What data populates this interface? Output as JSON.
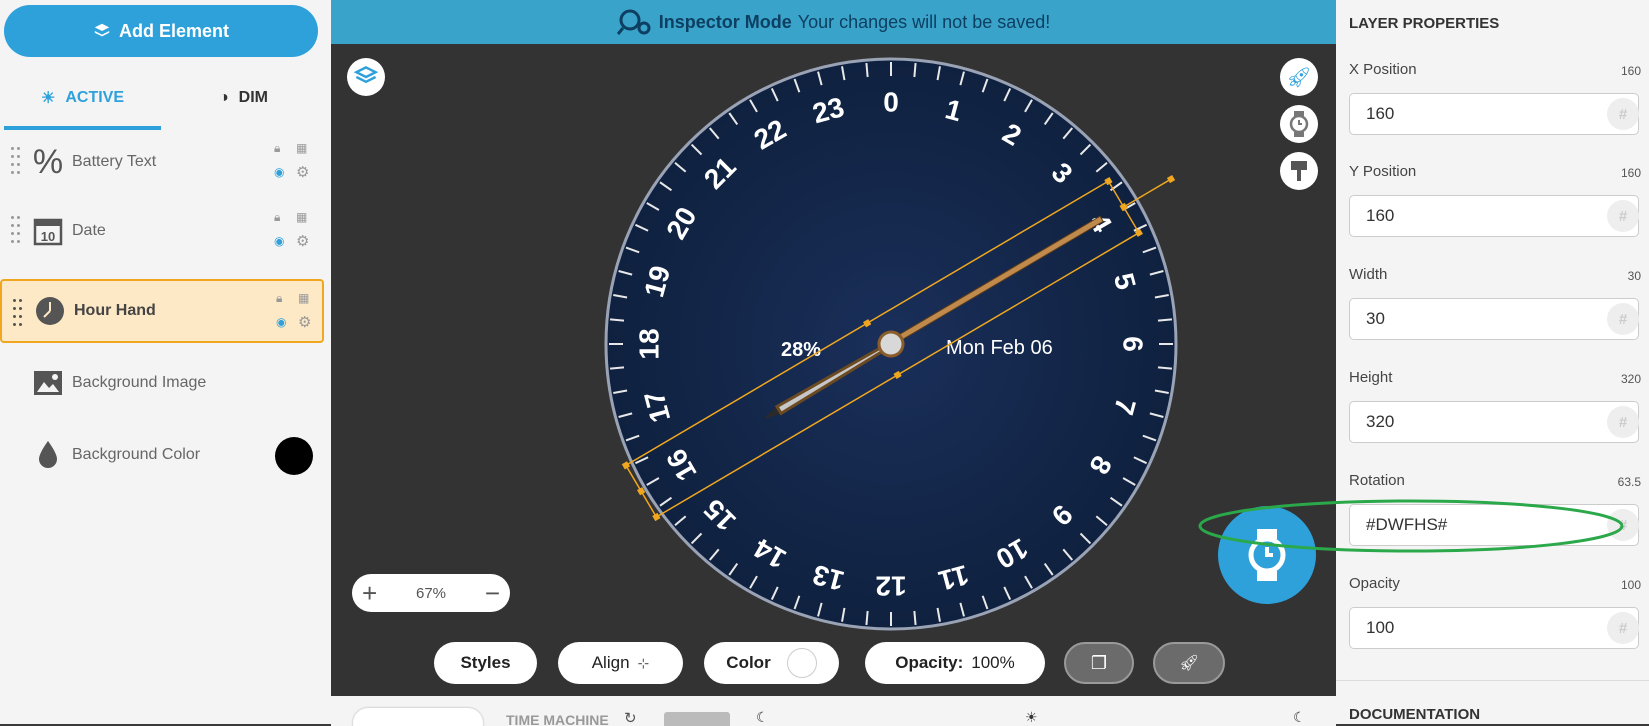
{
  "left_panel": {
    "add_button": "Add Element",
    "tabs": {
      "active": "ACTIVE",
      "dim": "DIM"
    },
    "layers": [
      {
        "name": "Battery Text",
        "icon": "percent-icon"
      },
      {
        "name": "Date",
        "icon": "calendar-icon"
      },
      {
        "name": "Hour Hand",
        "icon": "clock-icon",
        "selected": true
      },
      {
        "name": "Background Image",
        "icon": "image-icon"
      },
      {
        "name": "Background Color",
        "icon": "droplet-icon",
        "swatch": "#000000"
      }
    ]
  },
  "header": {
    "title": "Inspector Mode",
    "subtitle": "Your changes will not be saved!"
  },
  "watch": {
    "battery": "28%",
    "date": "Mon Feb 06",
    "hour_numbers": [
      "0",
      "1",
      "2",
      "3",
      "4",
      "5",
      "6",
      "7",
      "8",
      "9",
      "10",
      "11",
      "12",
      "13",
      "14",
      "15",
      "16",
      "17",
      "18",
      "19",
      "20",
      "21",
      "22",
      "23"
    ]
  },
  "canvas": {
    "zoom": "67%",
    "zoom_in": "+",
    "zoom_out": "−"
  },
  "toolbar": {
    "styles": "Styles",
    "align": "Align",
    "color": "Color",
    "opacity_label": "Opacity:",
    "opacity_value": "100%"
  },
  "timebar": {
    "label": "TIME MACHINE"
  },
  "right_panel": {
    "title": "LAYER PROPERTIES",
    "props": [
      {
        "label": "X Position",
        "value": "160",
        "input": "160"
      },
      {
        "label": "Y Position",
        "value": "160",
        "input": "160"
      },
      {
        "label": "Width",
        "value": "30",
        "input": "30"
      },
      {
        "label": "Height",
        "value": "320",
        "input": "320"
      },
      {
        "label": "Rotation",
        "value": "63.5",
        "input": "#DWFHS#"
      },
      {
        "label": "Opacity",
        "value": "100",
        "input": "100"
      }
    ],
    "hash_symbol": "#",
    "documentation": "DOCUMENTATION"
  },
  "colors": {
    "accent": "#2ea1db",
    "selection": "#f0a71f",
    "dial": "#13284f",
    "annotation": "#2aa84a"
  }
}
